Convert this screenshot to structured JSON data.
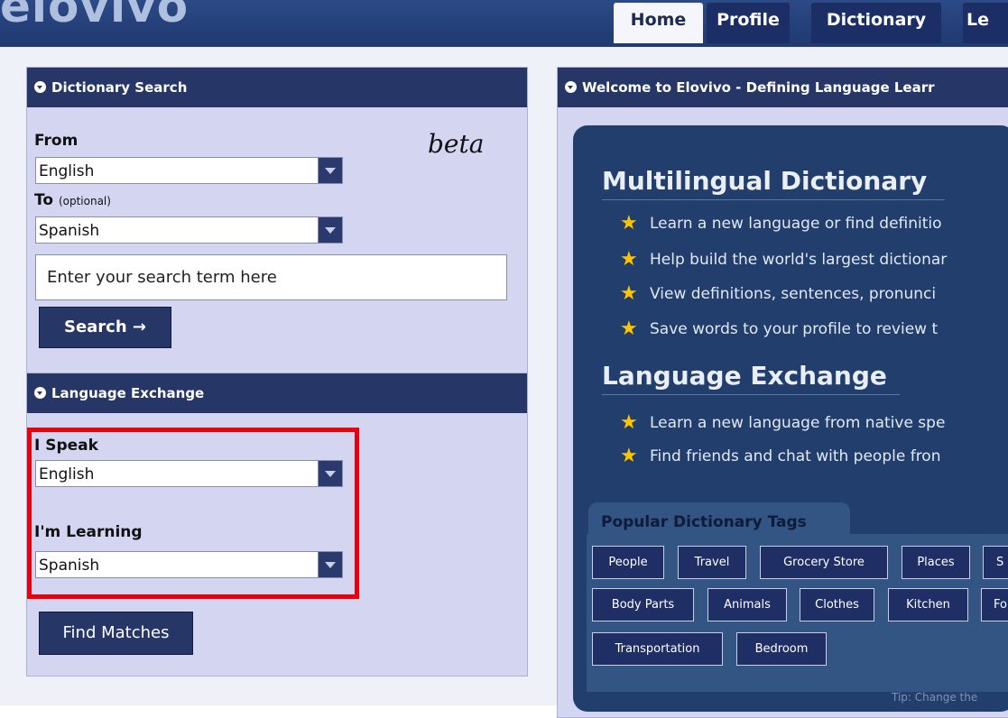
{
  "header": {
    "logo": "elovivo",
    "tabs": [
      "Home",
      "Profile",
      "Dictionary",
      "Le"
    ]
  },
  "dictionary_search": {
    "title": "Dictionary Search",
    "beta": "beta",
    "from_label": "From",
    "from_value": "English",
    "to_label": "To",
    "to_hint": "(optional)",
    "to_value": "Spanish",
    "search_placeholder": "Enter your search term here",
    "search_button": "Search →"
  },
  "language_exchange": {
    "title": "Language Exchange",
    "speak_label": "I Speak",
    "speak_value": "English",
    "learning_label": "I'm Learning",
    "learning_value": "Spanish",
    "find_button": "Find Matches"
  },
  "welcome": {
    "title": "Welcome to Elovivo - Defining Language Learr",
    "dictionary_heading": "Multilingual Dictionary",
    "dictionary_features": [
      "Learn a new language or find definitio",
      "Help build the world's largest dictionar",
      "View definitions, sentences, pronunci",
      "Save words to your profile to review t"
    ],
    "exchange_heading": "Language Exchange",
    "exchange_features": [
      "Learn a new language from native spe",
      "Find friends and chat with people fron"
    ],
    "tags_title": "Popular Dictionary Tags",
    "tags_row1": [
      "People",
      "Travel",
      "Grocery Store",
      "Places",
      "S"
    ],
    "tags_row2": [
      "Body Parts",
      "Animals",
      "Clothes",
      "Kitchen",
      "Fo"
    ],
    "tags_row3": [
      "Transportation",
      "Bedroom"
    ],
    "tip": "Tip: Change the"
  },
  "colors": {
    "header_bg": "#25407a",
    "panel_head": "#253667",
    "panel_bg": "#d4d6f1",
    "card_bg": "#223e6c",
    "highlight": "#e8000d",
    "star": "#ffc400"
  }
}
